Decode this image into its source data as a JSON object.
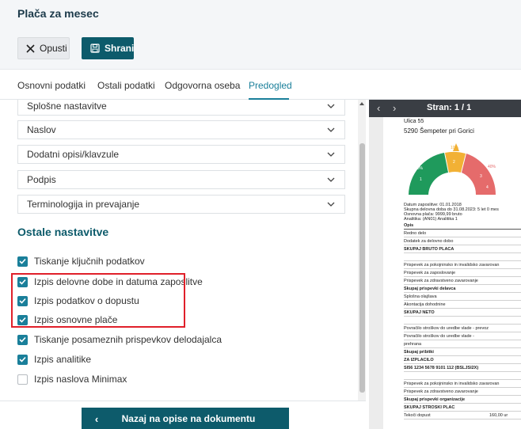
{
  "header": {
    "title": "Plača za mesec"
  },
  "toolbar": {
    "cancel_label": "Opusti",
    "save_label": "Shrani"
  },
  "tabs": [
    {
      "label": "Osnovni podatki",
      "active": false
    },
    {
      "label": "Ostali podatki",
      "active": false
    },
    {
      "label": "Odgovorna oseba",
      "active": false
    },
    {
      "label": "Predogled",
      "active": true
    }
  ],
  "accordions": [
    {
      "label": "Splošne nastavitve"
    },
    {
      "label": "Naslov"
    },
    {
      "label": "Dodatni opisi/klavzule"
    },
    {
      "label": "Podpis"
    },
    {
      "label": "Terminologija in prevajanje"
    }
  ],
  "other_settings": {
    "title": "Ostale nastavitve",
    "options": [
      {
        "label": "Tiskanje ključnih podatkov",
        "checked": true
      },
      {
        "label": "Izpis delovne dobe in datuma zaposlitve",
        "checked": true
      },
      {
        "label": "Izpis podatkov o dopustu",
        "checked": true
      },
      {
        "label": "Izpis osnovne plače",
        "checked": true
      },
      {
        "label": "Tiskanje posameznih prispevkov delodajalca",
        "checked": true
      },
      {
        "label": "Izpis analitike",
        "checked": true
      },
      {
        "label": "Izpis naslova Minimax",
        "checked": false
      }
    ]
  },
  "bottom": {
    "back_label": "Nazaj na opise na dokumentu"
  },
  "preview": {
    "page_label": "Stran: 1 / 1",
    "doc": {
      "street": "Ulica 55",
      "city": "5290    Šempeter pri Gorici",
      "gauge": {
        "left_label": "50%",
        "top_label": "10%",
        "right_label": "40%",
        "a": "1",
        "b": "2",
        "c": "3",
        "d": "4"
      },
      "info": [
        "Datum zaposlitve: 01.01.2018",
        "Skupna delovna doba do 31.08.2023: 5 let 0 mes",
        "Osnovna plača: 9999,99 bruto",
        "Analitika: (AN01) Analitika 1"
      ],
      "rows": [
        {
          "text": "Opis",
          "bold": true,
          "hd": true,
          "val": ""
        },
        {
          "text": "Redno delo",
          "bold": false,
          "val": ""
        },
        {
          "text": "Dodatek za delovno dobo",
          "bold": false,
          "val": ""
        },
        {
          "text": "SKUPAJ BRUTO PLAČA",
          "bold": true,
          "val": ""
        },
        {
          "text": "",
          "bold": false,
          "val": ""
        },
        {
          "text": "Prispevek za pokojninsko in invalidsko zavarovan",
          "bold": false,
          "val": ""
        },
        {
          "text": "Prispevek za zaposlovanje",
          "bold": false,
          "val": ""
        },
        {
          "text": "Prispevek za zdravstveno zavarovanje",
          "bold": false,
          "val": ""
        },
        {
          "text": "Skupaj prispevki delavca",
          "bold": true,
          "val": ""
        },
        {
          "text": "Splošna olajšava",
          "bold": false,
          "val": ""
        },
        {
          "text": "Akontacija dohodnine",
          "bold": false,
          "val": ""
        },
        {
          "text": "SKUPAJ NETO",
          "bold": true,
          "val": ""
        },
        {
          "text": "",
          "bold": false,
          "val": ""
        },
        {
          "text": "Povračilo stroškov do uredbe vlade - prevoz",
          "bold": false,
          "val": ""
        },
        {
          "text": "Povračilo stroškov do uredbe vlade -",
          "bold": false,
          "val": ""
        },
        {
          "text": "prehrana",
          "bold": false,
          "val": ""
        },
        {
          "text": "Skupaj pribitki",
          "bold": true,
          "val": ""
        },
        {
          "text": "ZA IZPLAČILO",
          "bold": true,
          "val": ""
        },
        {
          "text": "SI56 1234 5678 9101 112 (BSLJSI2X)",
          "bold": true,
          "val": ""
        },
        {
          "text": "",
          "bold": false,
          "val": ""
        },
        {
          "text": "Prispevek za pokojninsko in invalidsko zavarovan",
          "bold": false,
          "val": ""
        },
        {
          "text": "Prispevek za zdravstveno zavarovanje",
          "bold": false,
          "val": ""
        },
        {
          "text": "Skupaj prispevki organizacije",
          "bold": true,
          "val": ""
        },
        {
          "text": "SKUPAJ STROŠKI PLAČ",
          "bold": true,
          "val": ""
        },
        {
          "text": "Tekoči dopust",
          "bold": false,
          "val": "160,00 ur"
        }
      ]
    }
  },
  "colors": {
    "accent": "#0d5b6b",
    "link": "#1a7f9a",
    "highlight": "#e0202a"
  }
}
